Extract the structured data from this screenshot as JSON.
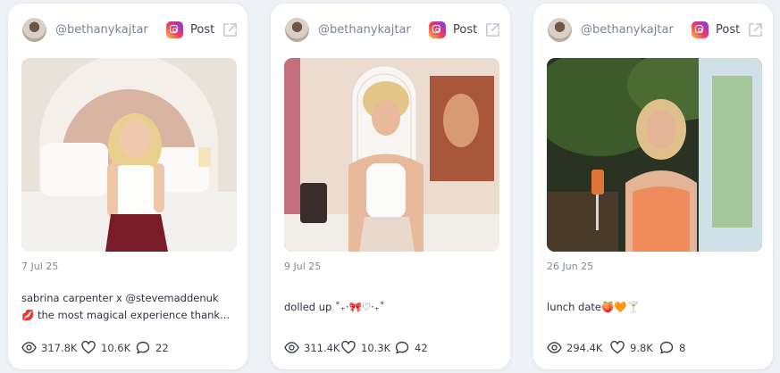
{
  "posts": [
    {
      "handle": "@bethanykajtar",
      "platform_icon": "instagram-icon",
      "post_type": "Post",
      "date": "7 Jul 25",
      "caption_line1": "sabrina carpenter x @stevemaddenuk",
      "caption_emoji": "💋",
      "caption_line2": " the most magical experience thank...",
      "views": "317.8K",
      "likes": "10.6K",
      "comments": "22"
    },
    {
      "handle": "@bethanykajtar",
      "platform_icon": "instagram-icon",
      "post_type": "Post",
      "date": "9 Jul 25",
      "caption": "dolled up ˚₊‧🎀♡‧₊˚",
      "views": "311.4K",
      "likes": "10.3K",
      "comments": "42"
    },
    {
      "handle": "@bethanykajtar",
      "platform_icon": "instagram-icon",
      "post_type": "Post",
      "date": "26 Jun 25",
      "caption": "lunch date🍑🧡🍸",
      "views": "294.4K",
      "likes": "9.8K",
      "comments": "8"
    }
  ],
  "colors": {
    "background": "#eef1f6",
    "card": "#ffffff",
    "muted_text": "#7b8494",
    "body_text": "#2e3340"
  }
}
